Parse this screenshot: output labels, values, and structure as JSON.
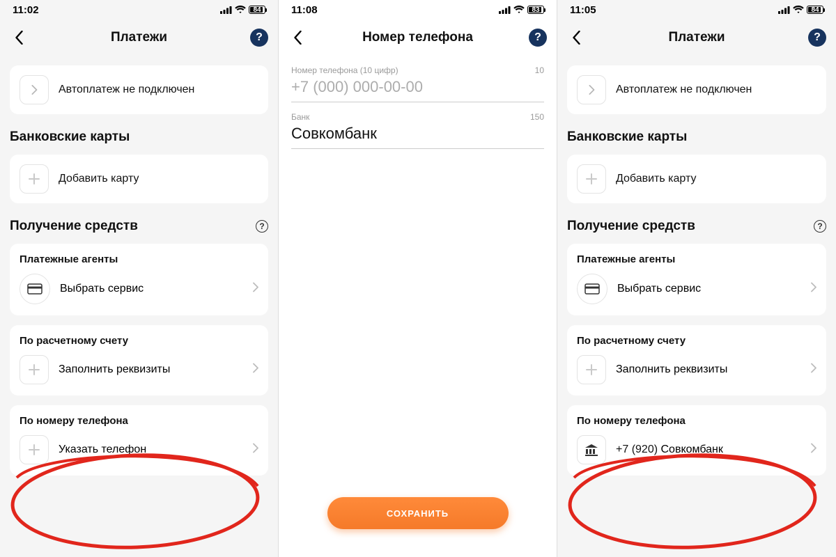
{
  "screens": [
    {
      "time": "11:02",
      "battery": "84",
      "title": "Платежи",
      "autopay": "Автоплатеж не подключен",
      "section_cards": "Банковские карты",
      "add_card": "Добавить карту",
      "section_receive": "Получение средств",
      "agents_title": "Платежные агенты",
      "agents_action": "Выбрать сервис",
      "account_title": "По расчетному счету",
      "account_action": "Заполнить реквизиты",
      "phone_title": "По номеру телефона",
      "phone_action": "Указать телефон"
    },
    {
      "time": "11:08",
      "battery": "83",
      "title": "Номер телефона",
      "phone_label": "Номер телефона (10 цифр)",
      "phone_limit": "10",
      "phone_placeholder": "+7 (000) 000-00-00",
      "bank_label": "Банк",
      "bank_limit": "150",
      "bank_value": "Совкомбанк",
      "save": "СОХРАНИТЬ"
    },
    {
      "time": "11:05",
      "battery": "84",
      "title": "Платежи",
      "autopay": "Автоплатеж не подключен",
      "section_cards": "Банковские карты",
      "add_card": "Добавить карту",
      "section_receive": "Получение средств",
      "agents_title": "Платежные агенты",
      "agents_action": "Выбрать сервис",
      "account_title": "По расчетному счету",
      "account_action": "Заполнить реквизиты",
      "phone_title": "По номеру телефона",
      "phone_number": "+7 (920)",
      "phone_bank": "Совкомбанк"
    }
  ],
  "help_glyph": "?"
}
